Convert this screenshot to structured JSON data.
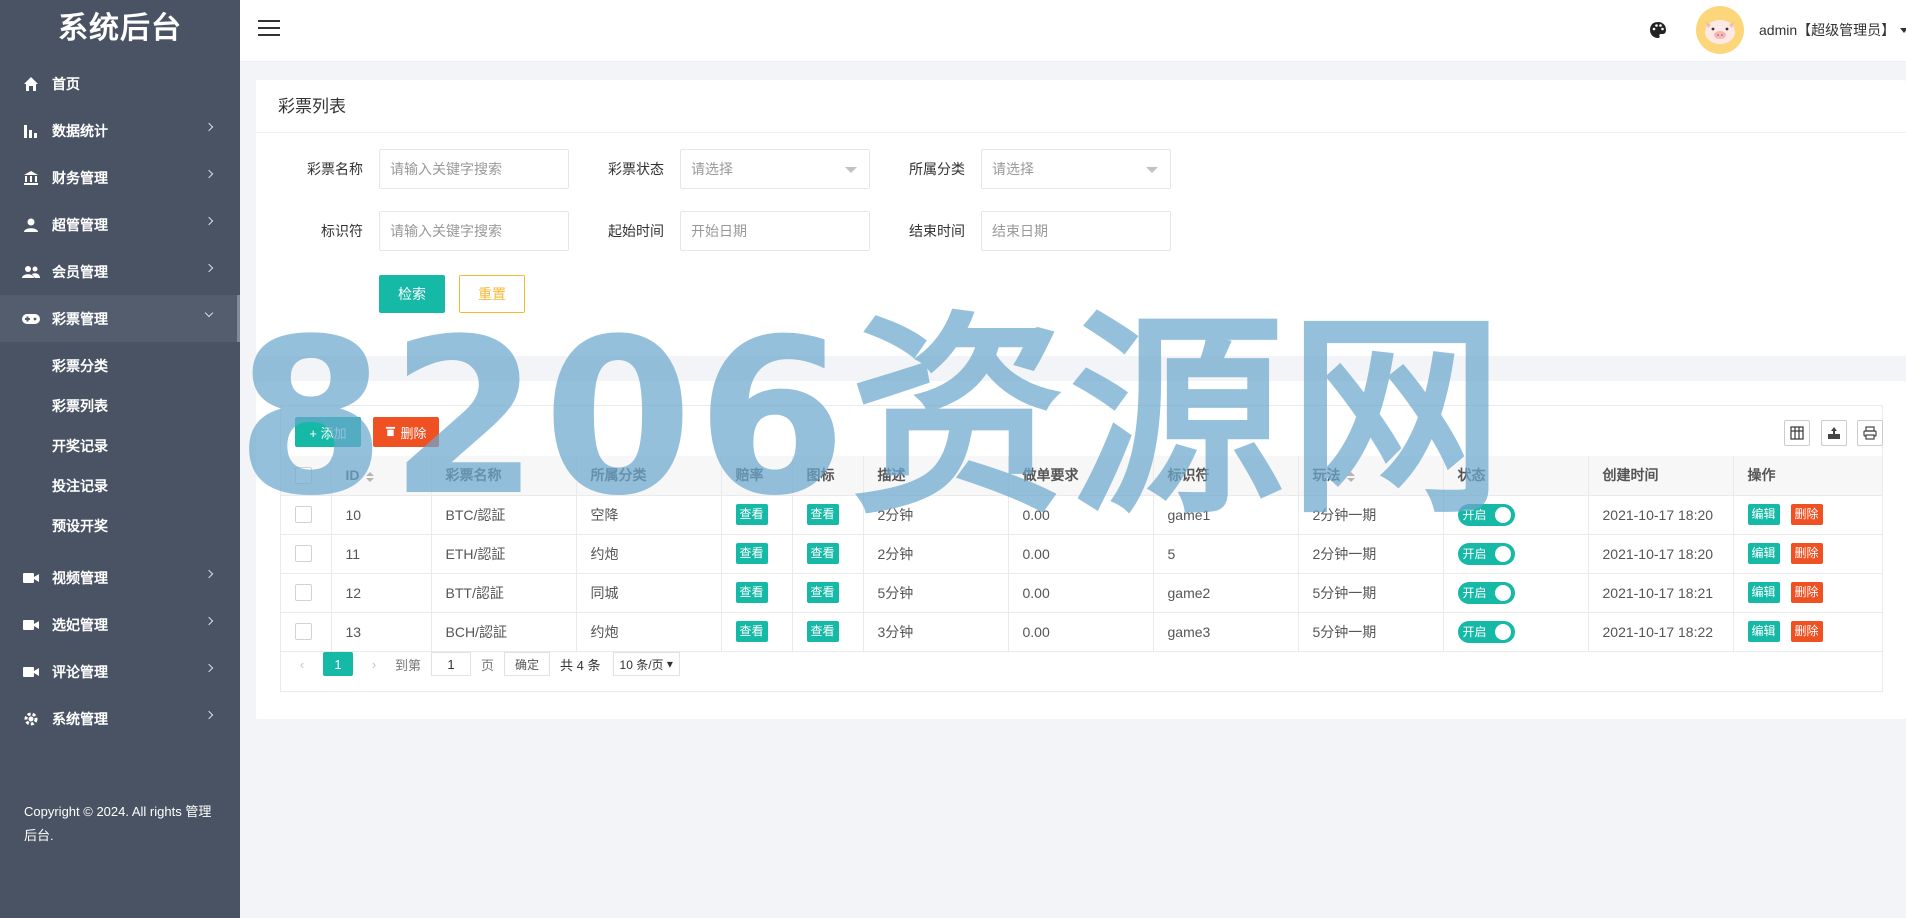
{
  "brand": "系统后台",
  "menu": [
    {
      "label": "首页",
      "icon": "home-icon",
      "arrow": false
    },
    {
      "label": "数据统计",
      "icon": "bar-chart-icon",
      "arrow": true
    },
    {
      "label": "财务管理",
      "icon": "bank-icon",
      "arrow": true
    },
    {
      "label": "超管管理",
      "icon": "user-icon",
      "arrow": true
    },
    {
      "label": "会员管理",
      "icon": "users-icon",
      "arrow": true
    },
    {
      "label": "彩票管理",
      "icon": "gamepad-icon",
      "arrow": true,
      "open": true
    }
  ],
  "submenu": [
    "彩票分类",
    "彩票列表",
    "开奖记录",
    "投注记录",
    "预设开奖"
  ],
  "menu_after": [
    {
      "label": "视频管理",
      "icon": "video-icon"
    },
    {
      "label": "选妃管理",
      "icon": "video-icon"
    },
    {
      "label": "评论管理",
      "icon": "video-icon"
    },
    {
      "label": "系统管理",
      "icon": "gear-icon"
    }
  ],
  "copyright": "Copyright © 2024. All rights 管理后台.",
  "header": {
    "user": "admin【超级管理员】"
  },
  "search": {
    "title": "彩票列表",
    "name_label": "彩票名称",
    "name_placeholder": "请输入关键字搜索",
    "status_label": "彩票状态",
    "status_placeholder": "请选择",
    "category_label": "所属分类",
    "category_placeholder": "请选择",
    "key_label": "标识符",
    "key_placeholder": "请输入关键字搜索",
    "start_label": "起始时间",
    "start_placeholder": "开始日期",
    "end_label": "结束时间",
    "end_placeholder": "结束日期",
    "search_btn": "检索",
    "reset_btn": "重置"
  },
  "toolbar": {
    "add": "+ 添加",
    "delete": "删除"
  },
  "table": {
    "headers": [
      "ID",
      "彩票名称",
      "所属分类",
      "赔率",
      "图标",
      "描述",
      "做单要求",
      "标识符",
      "玩法",
      "状态",
      "创建时间",
      "操作"
    ],
    "view_label": "查看",
    "switch_label": "开启",
    "edit_label": "编辑",
    "del_label": "删除",
    "rows": [
      {
        "id": "10",
        "name": "BTC/認証",
        "category": "空降",
        "desc": "2分钟",
        "req": "0.00",
        "key": "game1",
        "play": "2分钟一期",
        "created": "2021-10-17 18:20"
      },
      {
        "id": "11",
        "name": "ETH/認証",
        "category": "约炮",
        "desc": "2分钟",
        "req": "0.00",
        "key": "5",
        "play": "2分钟一期",
        "created": "2021-10-17 18:20"
      },
      {
        "id": "12",
        "name": "BTT/認証",
        "category": "同城",
        "desc": "5分钟",
        "req": "0.00",
        "key": "game2",
        "play": "5分钟一期",
        "created": "2021-10-17 18:21"
      },
      {
        "id": "13",
        "name": "BCH/認証",
        "category": "约炮",
        "desc": "3分钟",
        "req": "0.00",
        "key": "game3",
        "play": "5分钟一期",
        "created": "2021-10-17 18:22"
      }
    ]
  },
  "pager": {
    "current": "1",
    "goto_label": "到第",
    "page_value": "1",
    "page_label": "页",
    "ok": "确定",
    "total": "共 4 条",
    "per_page": "10 条/页"
  },
  "watermark": "8206资源网",
  "colors": {
    "sidebar": "#4a5363",
    "primary": "#16b8a6",
    "danger": "#f05123",
    "warning": "#f5b833"
  }
}
